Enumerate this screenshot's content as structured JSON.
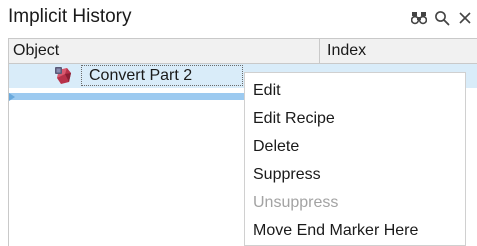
{
  "window": {
    "title": "Implicit History",
    "icons": [
      "binoculars-icon",
      "search-icon",
      "close-icon"
    ]
  },
  "grid": {
    "columns": [
      "Object",
      "Index"
    ],
    "rows": [
      {
        "object": "Convert Part 2",
        "icon": "convert-part-icon",
        "selected": true
      }
    ]
  },
  "context_menu": {
    "items": [
      {
        "label": "Edit",
        "enabled": true
      },
      {
        "label": "Edit Recipe",
        "enabled": true
      },
      {
        "label": "Delete",
        "enabled": true
      },
      {
        "label": "Suppress",
        "enabled": true
      },
      {
        "label": "Unsuppress",
        "enabled": false
      },
      {
        "label": "Move End Marker Here",
        "enabled": true
      }
    ]
  },
  "colors": {
    "selection": "#d9ecf9",
    "end_marker": "#9ccaf0",
    "disabled_text": "#a3a3a3"
  }
}
